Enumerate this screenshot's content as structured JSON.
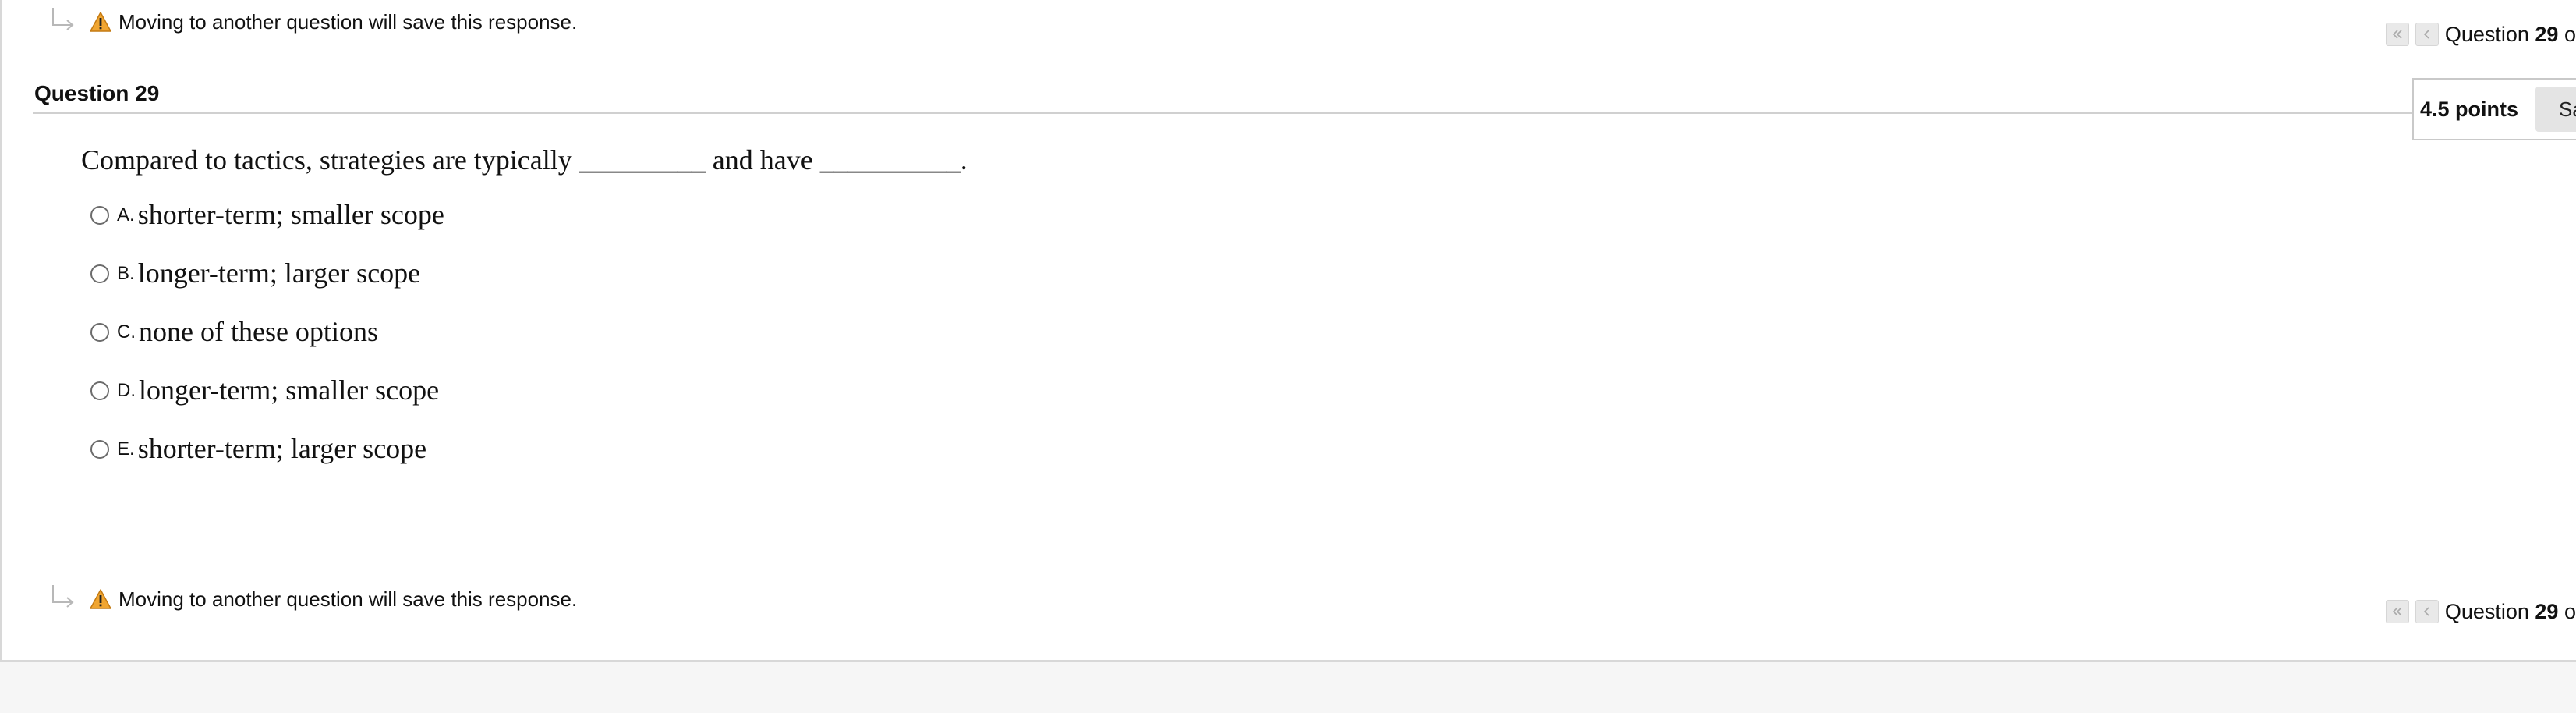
{
  "notice": {
    "text": "Moving to another question will save this response."
  },
  "navigation": {
    "first_icon": "double-chevron-left-icon",
    "prev_icon": "chevron-left-icon",
    "label_prefix": "Question",
    "current": "29",
    "label_suffix": "o"
  },
  "question": {
    "title": "Question 29",
    "points": "4.5 points",
    "save_label": "Sav",
    "text": "Compared to tactics, strategies are typically _________ and have __________.",
    "options": [
      {
        "letter": "A.",
        "text": "shorter-term; smaller scope"
      },
      {
        "letter": "B.",
        "text": "longer-term; larger scope"
      },
      {
        "letter": "C.",
        "text": "none of these options"
      },
      {
        "letter": "D.",
        "text": "longer-term; smaller scope"
      },
      {
        "letter": "E.",
        "text": "shorter-term; larger scope"
      }
    ]
  },
  "colors": {
    "warning": "#f0a531",
    "rule": "#d0d0d0",
    "background": "#f6f6f6"
  }
}
